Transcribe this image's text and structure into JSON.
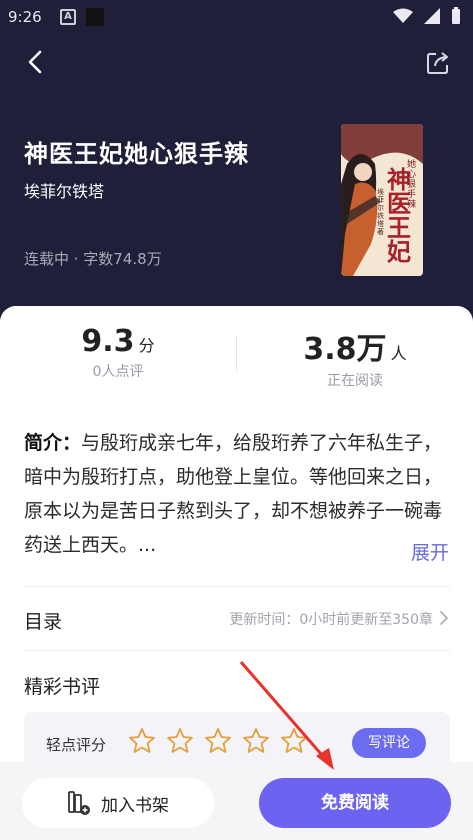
{
  "status_bar": {
    "time": "9:26",
    "a_glyph": "A"
  },
  "book": {
    "title": "神医王妃她心狠手辣",
    "author": "埃菲尔铁塔",
    "meta": "连载中 · 字数74.8万",
    "cover_text": "神医王妃",
    "cover_subtext": "她心狠手辣",
    "cover_author": "埃菲尔铁塔 著"
  },
  "stats": {
    "rating_value": "9.3",
    "rating_unit": "分",
    "rating_label": "0人点评",
    "readers_value": "3.8万",
    "readers_unit": "人",
    "readers_label": "正在阅读"
  },
  "intro": {
    "label": "简介：",
    "text": "与殷珩成亲七年，给殷珩养了六年私生子，暗中为殷珩打点，助他登上皇位。等他回来之日，原本以为是苦日子熬到头了，却不想被养子一碗毒药送上西天。...",
    "more": "展开"
  },
  "toc": {
    "title": "目录",
    "update": "更新时间：0小时前更新至350章"
  },
  "reviews": {
    "title": "精彩书评",
    "rating_label": "轻点评分",
    "stars": 5,
    "write_label": "写评论"
  },
  "bottom": {
    "shelf_label": "加入书架",
    "read_label": "免费阅读"
  },
  "colors": {
    "header_bg": "#1f1f3a",
    "accent": "#6c63f0",
    "star_outline": "#e3a03a",
    "arrow": "#e8322a"
  }
}
